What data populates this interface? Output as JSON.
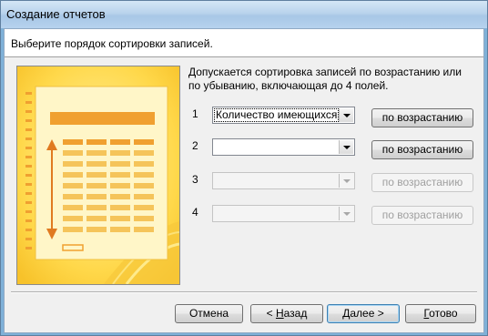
{
  "window": {
    "title": "Создание отчетов"
  },
  "header": {
    "instruction": "Выберите порядок сортировки записей."
  },
  "description": "Допускается сортировка записей по возрастанию или по убыванию, включающая до 4 полей.",
  "sort_fields": [
    {
      "number": "1",
      "value": "Количество имеющихся экз",
      "enabled": true,
      "order_label": "по возрастанию"
    },
    {
      "number": "2",
      "value": "",
      "enabled": true,
      "order_label": "по возрастанию"
    },
    {
      "number": "3",
      "value": "",
      "enabled": false,
      "order_label": "по возрастанию"
    },
    {
      "number": "4",
      "value": "",
      "enabled": false,
      "order_label": "по возрастанию"
    }
  ],
  "buttons": {
    "cancel": "Отмена",
    "back_prefix": "< ",
    "back_accel": "Н",
    "back_rest": "азад",
    "next_accel": "Д",
    "next_rest": "алее >",
    "finish_accel": "Г",
    "finish_rest": "отово"
  },
  "colors": {
    "illustration_bg": "#ffd84a",
    "illustration_accent": "#f2a02a",
    "title_bar": "#b9d3ec"
  }
}
